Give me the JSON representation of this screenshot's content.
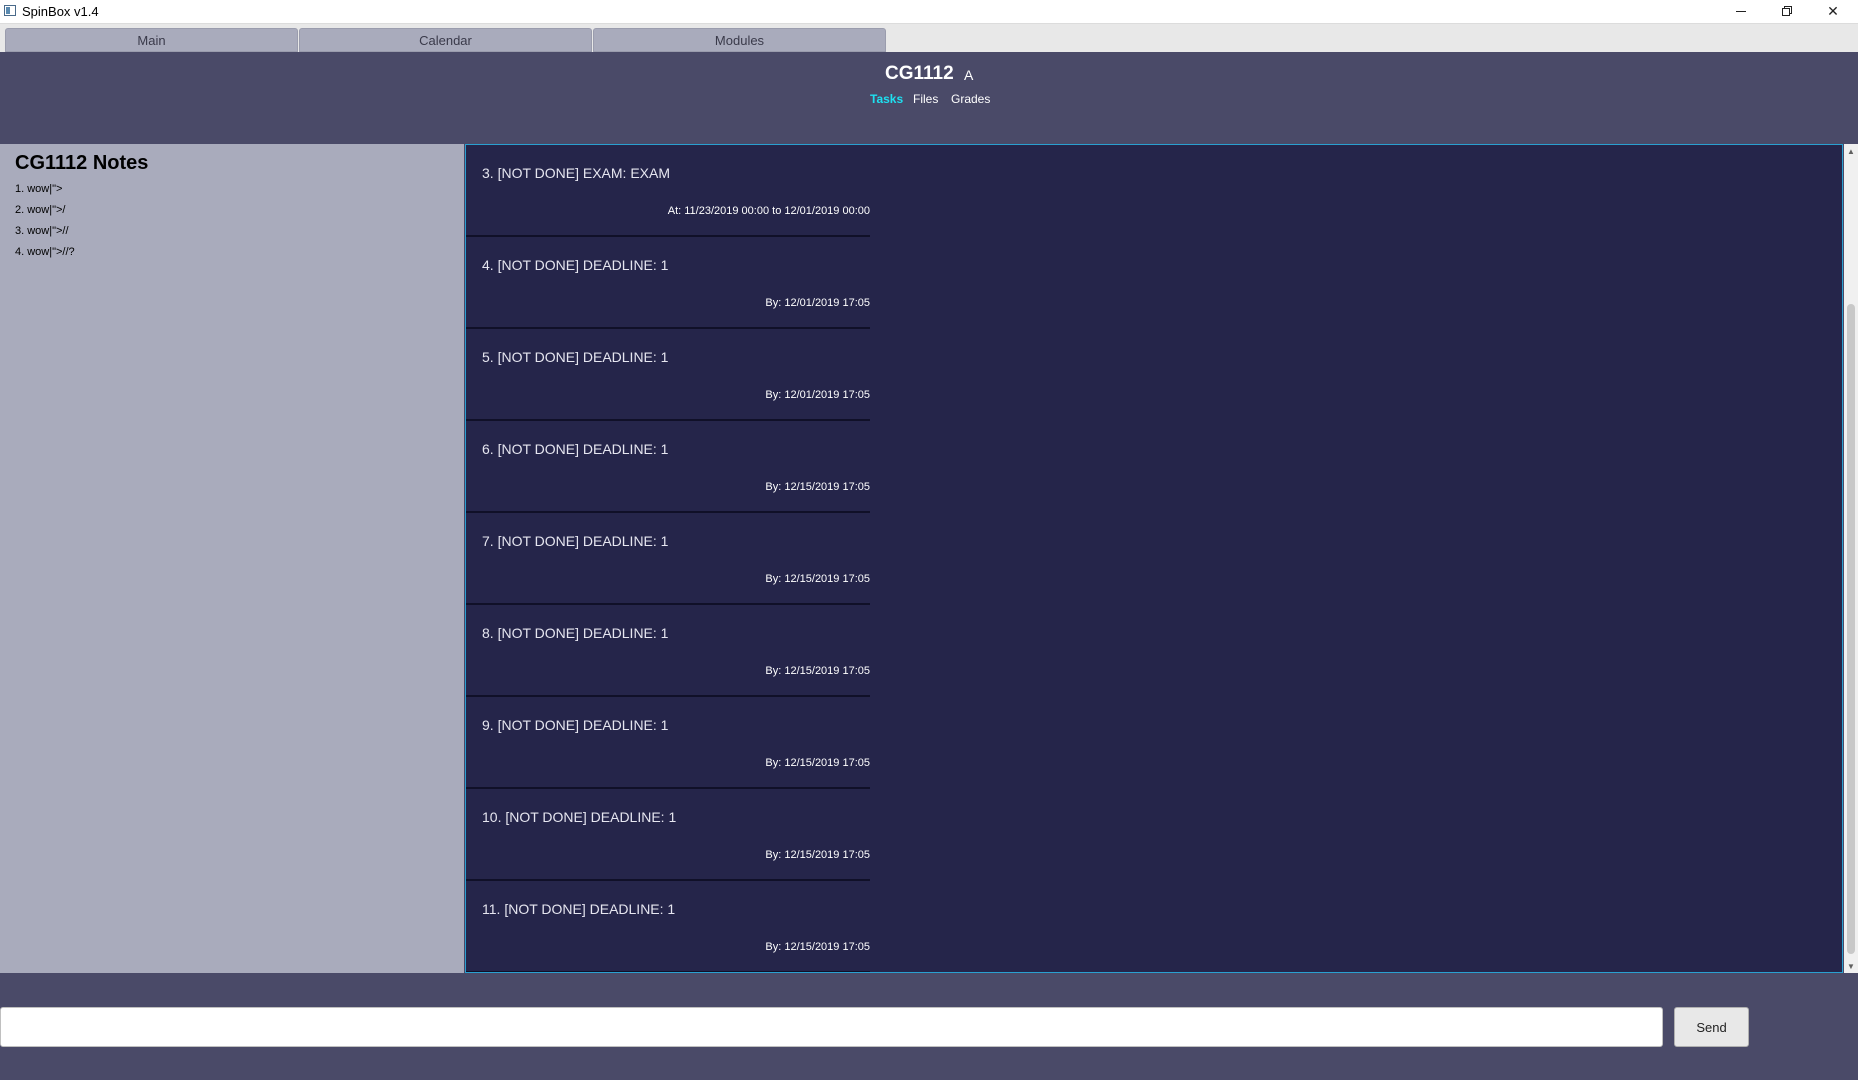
{
  "window": {
    "title": "SpinBox v1.4",
    "controls": {
      "minimize": "minimize-icon",
      "maximize": "restore-icon",
      "close": "close-icon"
    }
  },
  "tabs": [
    {
      "label": "Main"
    },
    {
      "label": "Calendar"
    },
    {
      "label": "Modules"
    }
  ],
  "header": {
    "module_code": "CG1112",
    "grade": "A",
    "subtabs": [
      {
        "label": "Tasks",
        "active": true
      },
      {
        "label": "Files",
        "active": false
      },
      {
        "label": "Grades",
        "active": false
      }
    ]
  },
  "notes": {
    "title": "CG1112 Notes",
    "items": [
      "1. wow|\">",
      "2. wow|\">/",
      "3. wow|\">//",
      "4. wow|\">//?"
    ]
  },
  "tasks": [
    {
      "title": "3. [NOT DONE] EXAM: EXAM",
      "date": "At: 11/23/2019 00:00 to 12/01/2019 00:00"
    },
    {
      "title": "4. [NOT DONE] DEADLINE: 1",
      "date": "By: 12/01/2019 17:05"
    },
    {
      "title": "5. [NOT DONE] DEADLINE: 1",
      "date": "By: 12/01/2019 17:05"
    },
    {
      "title": "6. [NOT DONE] DEADLINE: 1",
      "date": "By: 12/15/2019 17:05"
    },
    {
      "title": "7. [NOT DONE] DEADLINE: 1",
      "date": "By: 12/15/2019 17:05"
    },
    {
      "title": "8. [NOT DONE] DEADLINE: 1",
      "date": "By: 12/15/2019 17:05"
    },
    {
      "title": "9. [NOT DONE] DEADLINE: 1",
      "date": "By: 12/15/2019 17:05"
    },
    {
      "title": "10. [NOT DONE] DEADLINE: 1",
      "date": "By: 12/15/2019 17:05"
    },
    {
      "title": "11. [NOT DONE] DEADLINE: 1",
      "date": "By: 12/15/2019 17:05"
    }
  ],
  "command": {
    "value": "",
    "placeholder": "",
    "send_label": "Send"
  },
  "colors": {
    "header_bg": "#4a4a68",
    "notes_bg": "#a9abbc",
    "tasks_bg": "#25254a",
    "active_subtab": "#1ee0f0"
  }
}
